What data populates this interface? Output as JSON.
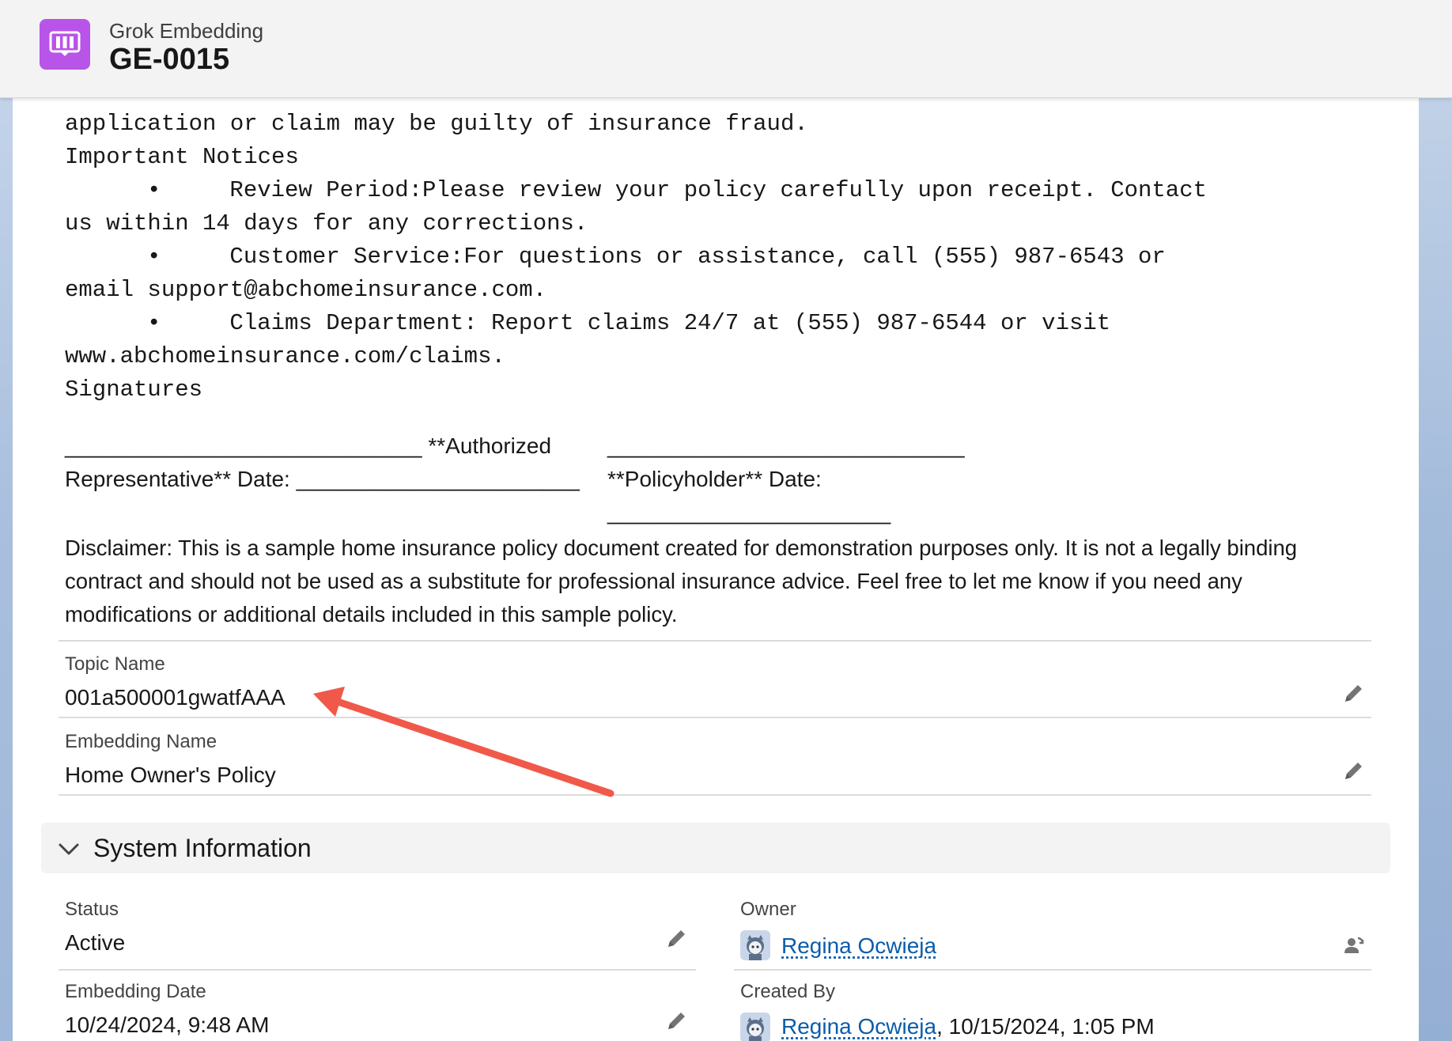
{
  "header": {
    "object_type": "Grok Embedding",
    "record_name": "GE-0015"
  },
  "content": {
    "partial_line": "application or claim may be guilty of insurance fraud.",
    "notices_heading": "Important Notices",
    "bullet1_line1": "•     Review Period:Please review your policy carefully upon receipt. Contact",
    "bullet1_line2": "us within 14 days for any corrections.",
    "bullet2_line1": "•     Customer Service:For questions or assistance, call (555) 987-6543 or",
    "bullet2_line2": "email support@abchomeinsurance.com.",
    "bullet3_line1": "•     Claims Department: Report claims 24/7 at (555) 987-6544 or visit",
    "bullet3_line2": "www.abchomeinsurance.com/claims.",
    "signatures_heading": "Signatures",
    "sig_left_line1": "_____________________________ **Authorized",
    "sig_left_line2": "Representative** Date: _______________________",
    "sig_right_line1": "_____________________________",
    "sig_right_line2": "**Policyholder** Date:",
    "sig_right_line3": "_______________________",
    "disclaimer": "Disclaimer: This is a sample home insurance policy document created for demonstration purposes only. It is not a legally binding contract and should not be used as a substitute for professional insurance advice. Feel free to let me know if you need any modifications or additional details included in this sample policy."
  },
  "fields": {
    "topic_name_label": "Topic Name",
    "topic_name_value": "001a500001gwatfAAA",
    "embedding_name_label": "Embedding Name",
    "embedding_name_value": "Home Owner's Policy"
  },
  "system_info": {
    "title": "System Information",
    "status_label": "Status",
    "status_value": "Active",
    "owner_label": "Owner",
    "owner_value": "Regina Ocwieja",
    "embedding_date_label": "Embedding Date",
    "embedding_date_value": "10/24/2024, 9:48 AM",
    "created_by_label": "Created By",
    "created_by_name": "Regina Ocwieja",
    "created_by_date": ", 10/15/2024, 1:05 PM"
  },
  "colors": {
    "app_icon": "#b954e8",
    "link": "#0b5cab",
    "annotation_arrow": "#f0594a"
  },
  "icons": [
    "app-icon",
    "pencil-icon",
    "chevron-down-icon",
    "change-owner-icon",
    "user-avatar-icon",
    "annotation-arrow"
  ]
}
